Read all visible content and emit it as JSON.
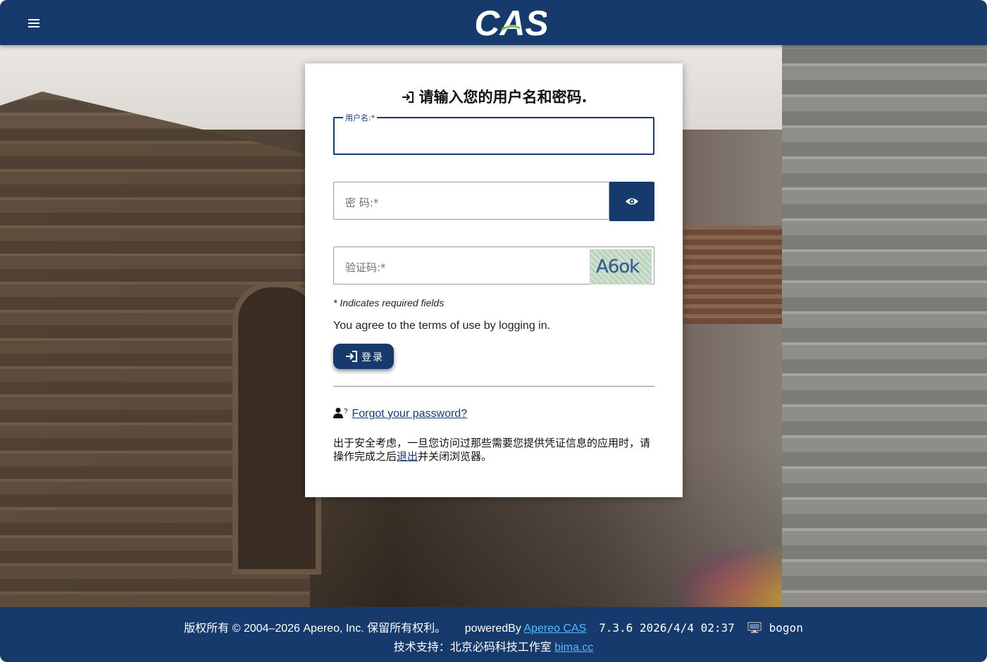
{
  "header": {
    "logo_text": "CAS",
    "brand_color": "#153a6b"
  },
  "form": {
    "title": "请输入您的用户名和密码.",
    "username": {
      "label": "用户名:*",
      "value": ""
    },
    "password": {
      "placeholder": "密 码:*",
      "value": ""
    },
    "captcha": {
      "placeholder": "验证码:*",
      "image_text": "A6ok"
    },
    "required_note": "* Indicates required fields",
    "terms": "You agree to the terms of use by logging in.",
    "login_label": "登录",
    "forgot_password": "Forgot your password?",
    "notice_pre": "出于安全考虑，一旦您访问过那些需要您提供凭证信息的应用时，请操作完成之后",
    "notice_link": "退出",
    "notice_post": "并关闭浏览器。"
  },
  "footer": {
    "copyright": "版权所有 © 2004–2026 Apereo, Inc. 保留所有权利。",
    "powered_by_prefix": "poweredBy",
    "powered_by_link": "Apereo CAS",
    "version_info": "7.3.6 2026/4/4 02:37",
    "hostname": "bogon",
    "support_prefix": "技术支持：北京必码科技工作室",
    "support_link": "bima.cc",
    "link_color": "#5ab8ff"
  }
}
